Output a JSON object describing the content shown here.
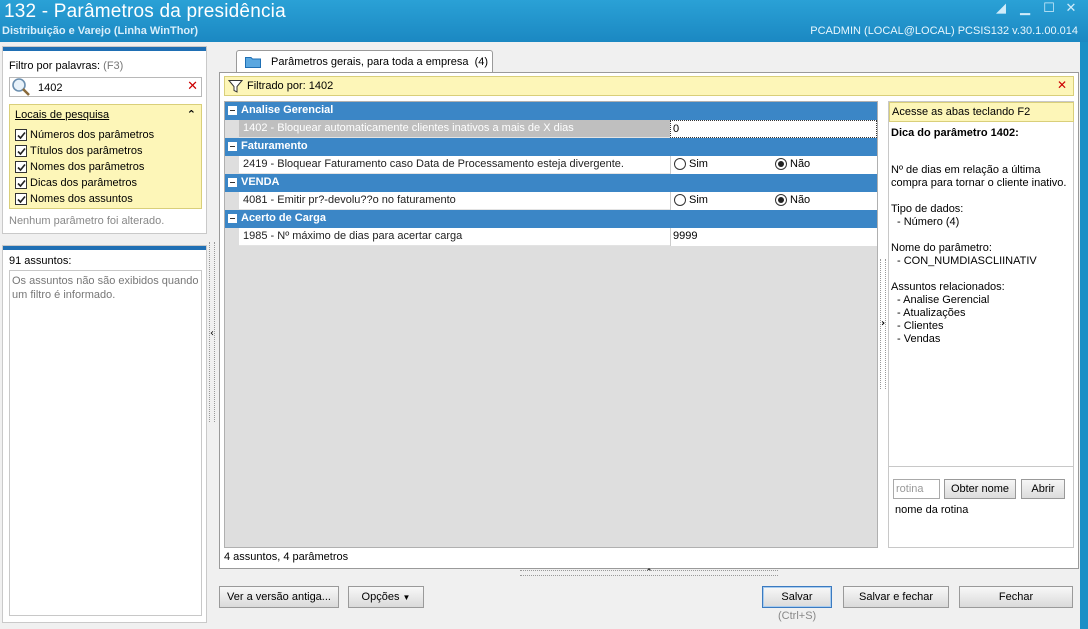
{
  "window": {
    "title": "132 - Parâmetros da presidência",
    "subtitle": "Distribuição e Varejo (Linha WinThor)",
    "user_info": "PCADMIN (LOCAL@LOCAL)   PCSIS132  v.30.1.00.014"
  },
  "filter": {
    "label": "Filtro por palavras:",
    "shortcut": "(F3)",
    "value": "1402",
    "locais": {
      "header": "Locais de pesquisa",
      "items": [
        {
          "label": "Números dos parâmetros",
          "checked": true
        },
        {
          "label": "Títulos dos parâmetros",
          "checked": true
        },
        {
          "label": "Nomes dos parâmetros",
          "checked": true
        },
        {
          "label": "Dicas dos parâmetros",
          "checked": true
        },
        {
          "label": "Nomes dos assuntos",
          "checked": true
        }
      ]
    },
    "no_changes": "Nenhum parâmetro foi alterado."
  },
  "subjects": {
    "count": "91 assuntos:",
    "message": "Os assuntos não são exibidos quando um filtro é informado."
  },
  "tab": {
    "label": "Parâmetros gerais, para toda a empresa",
    "count": "(4)"
  },
  "filter_bar": {
    "text": "Filtrado por: 1402"
  },
  "groups": [
    {
      "title": "Analise Gerencial",
      "rows": [
        {
          "desc": "1402 - Bloquear automaticamente clientes inativos a mais de X dias",
          "value": "0",
          "type": "text",
          "selected": true
        }
      ]
    },
    {
      "title": "Faturamento",
      "rows": [
        {
          "desc": "2419 - Bloquear Faturamento caso Data de Processamento esteja divergente.",
          "type": "radio",
          "opt1": "Sim",
          "opt2": "Não",
          "selected_opt": "Não"
        }
      ]
    },
    {
      "title": "VENDA",
      "rows": [
        {
          "desc": "4081 - Emitir pr?-devolu??o no faturamento",
          "type": "radio",
          "opt1": "Sim",
          "opt2": "Não",
          "selected_opt": "Não"
        }
      ]
    },
    {
      "title": "Acerto de Carga",
      "rows": [
        {
          "desc": "1985 - Nº máximo de dias para acertar carga",
          "value": "9999",
          "type": "text"
        }
      ]
    }
  ],
  "grid_status": "4 assuntos, 4 parâmetros",
  "tips": {
    "hint": "Acesse as abas teclando F2",
    "title": "Dica do parâmetro 1402:",
    "description": "Nº de dias em relação a última compra para tornar o cliente inativo.",
    "data_type_label": "Tipo de dados:",
    "data_type_value": "- Número (4)",
    "param_name_label": "Nome do parâmetro:",
    "param_name_value": "- CON_NUMDIASCLIINATIV",
    "related_label": "Assuntos relacionados:",
    "related": [
      "- Analise Gerencial",
      "- Atualizações",
      "- Clientes",
      "- Vendas"
    ],
    "rotina_placeholder": "rotina",
    "get_name_label": "Obter nome",
    "open_label": "Abrir",
    "rotina_caption": "nome da rotina"
  },
  "buttons": {
    "old_version": "Ver a versão antiga...",
    "options": "Opções",
    "save": "Salvar",
    "save_shortcut": "(Ctrl+S)",
    "save_close": "Salvar e fechar",
    "close": "Fechar"
  }
}
